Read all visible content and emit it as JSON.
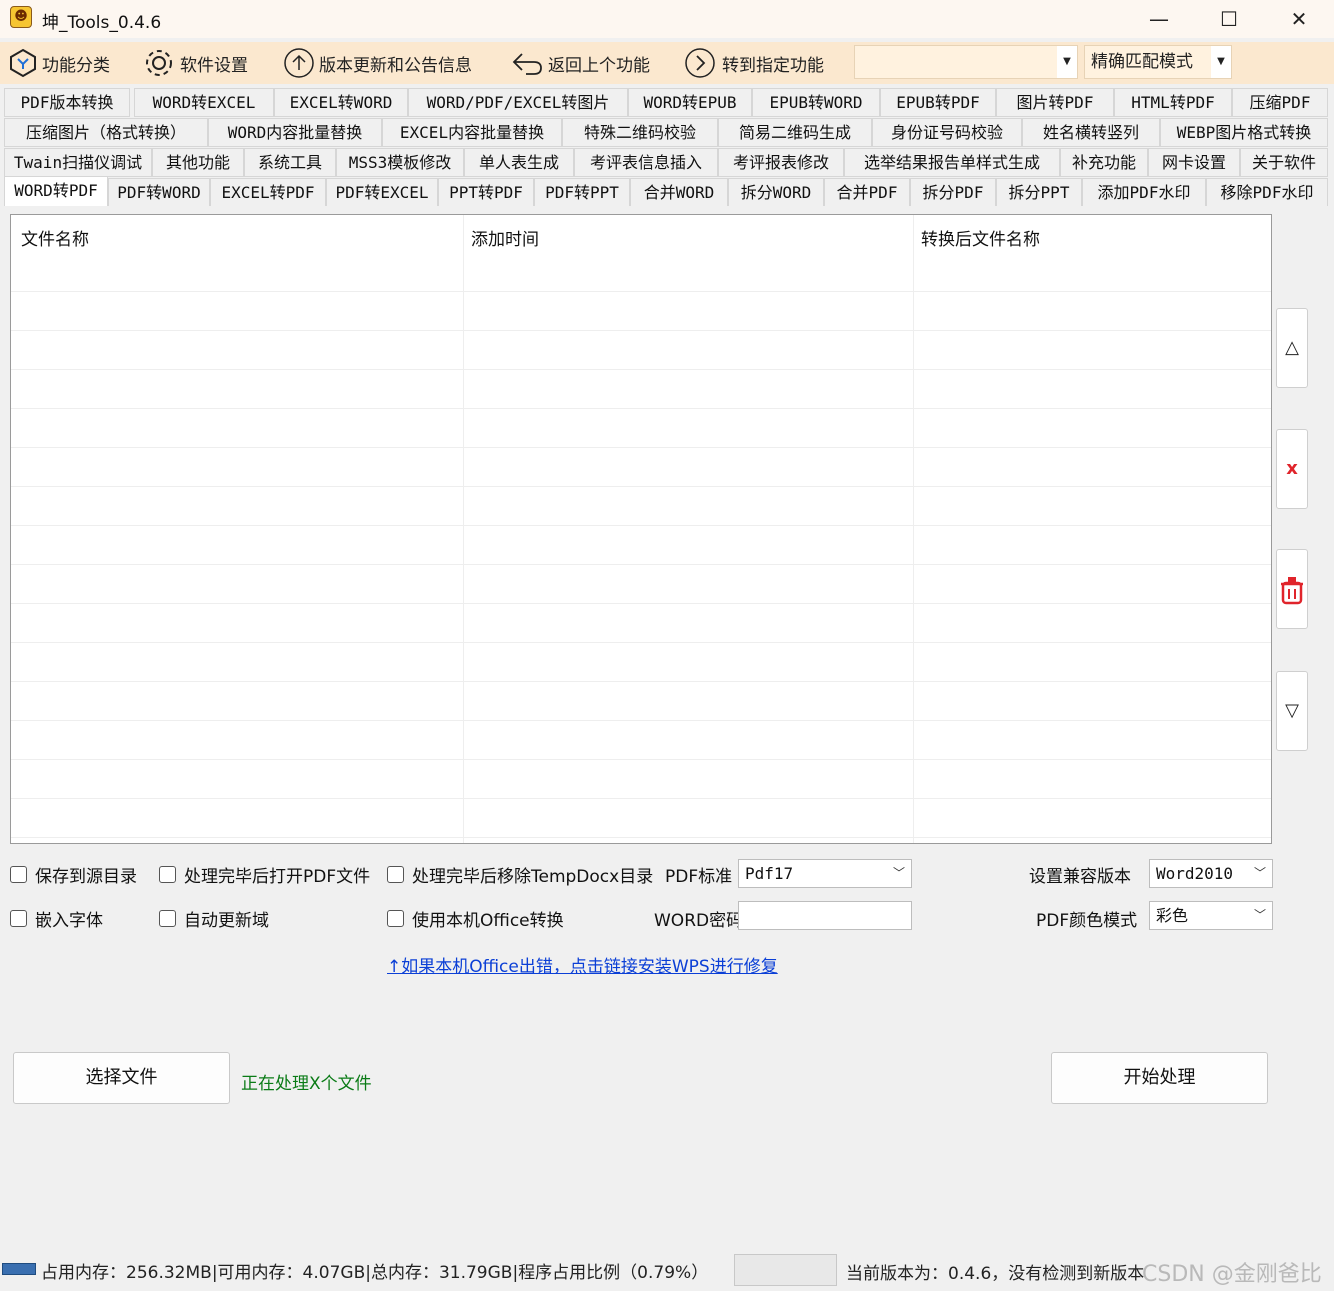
{
  "window": {
    "title": "坤_Tools_0.4.6",
    "min_glyph": "—",
    "max_glyph": "☐",
    "close_glyph": "✕"
  },
  "toolbar": {
    "categories": "功能分类",
    "settings": "软件设置",
    "updates": "版本更新和公告信息",
    "back": "返回上个功能",
    "goto": "转到指定功能",
    "goto_combo_value": "",
    "match_mode": "精确匹配模式"
  },
  "tabs": {
    "row1": [
      "PDF版本转换",
      "WORD转EXCEL",
      "EXCEL转WORD",
      "WORD/PDF/EXCEL转图片",
      "WORD转EPUB",
      "EPUB转WORD",
      "EPUB转PDF",
      "图片转PDF",
      "HTML转PDF",
      "压缩PDF"
    ],
    "row2": [
      "压缩图片（格式转换）",
      "WORD内容批量替换",
      "EXCEL内容批量替换",
      "特殊二维码校验",
      "简易二维码生成",
      "身份证号码校验",
      "姓名横转竖列",
      "WEBP图片格式转换"
    ],
    "row3": [
      "Twain扫描仪调试",
      "其他功能",
      "系统工具",
      "MSS3模板修改",
      "单人表生成",
      "考评表信息插入",
      "考评报表修改",
      "选举结果报告单样式生成",
      "补充功能",
      "网卡设置",
      "关于软件"
    ],
    "row4": [
      "WORD转PDF",
      "PDF转WORD",
      "EXCEL转PDF",
      "PDF转EXCEL",
      "PPT转PDF",
      "PDF转PPT",
      "合并WORD",
      "拆分WORD",
      "合并PDF",
      "拆分PDF",
      "拆分PPT",
      "添加PDF水印",
      "移除PDF水印"
    ],
    "active": "WORD转PDF"
  },
  "file_list": {
    "columns": [
      "文件名称",
      "添加时间",
      "转换后文件名称"
    ],
    "rows": []
  },
  "side_buttons": {
    "move_up": "△",
    "remove": "x",
    "clear": "🗑",
    "move_down": "▽"
  },
  "options": {
    "save_to_source": "保存到源目录",
    "open_pdf_after": "处理完毕后打开PDF文件",
    "remove_tempdocx": "处理完毕后移除TempDocx目录",
    "pdf_standard_label": "PDF标准",
    "pdf_standard_value": "Pdf17",
    "compat_label": "设置兼容版本",
    "compat_value": "Word2010",
    "embed_fonts": "嵌入字体",
    "auto_update_fields": "自动更新域",
    "use_local_office": "使用本机Office转换",
    "word_password_label": "WORD密码",
    "word_password_value": "",
    "pdf_color_label": "PDF颜色模式",
    "pdf_color_value": "彩色"
  },
  "wps_link": "↑如果本机Office出错，点击链接安装WPS进行修复",
  "actions": {
    "select_file": "选择文件",
    "processing_status": "正在处理X个文件",
    "start": "开始处理"
  },
  "statusbar": {
    "memory": "占用内存：256.32MB|可用内存：4.07GB|总内存：31.79GB|程序占用比例（0.79%）",
    "version": "当前版本为：0.4.6，没有检测到新版本",
    "watermark": "CSDN @金刚爸比"
  },
  "colors": {
    "toolbar_bg": "#fbe8cf",
    "link": "#0b3fd6",
    "status_green": "#0a7b16",
    "remove_red": "#e0242b"
  }
}
